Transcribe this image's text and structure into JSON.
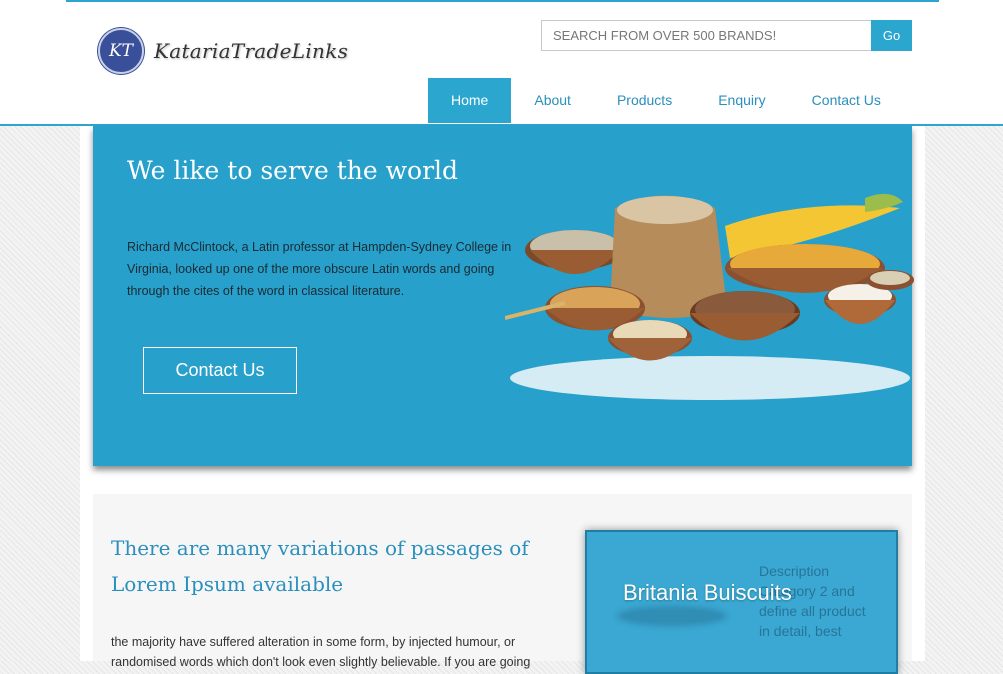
{
  "brand": {
    "logo_mark": "KT",
    "name": "KatariaTradeLinks"
  },
  "search": {
    "placeholder": "SEARCH FROM OVER 500 BRANDS!",
    "button_label": "Go"
  },
  "nav": [
    {
      "label": "Home",
      "active": true
    },
    {
      "label": "About"
    },
    {
      "label": "Products"
    },
    {
      "label": "Enquiry"
    },
    {
      "label": "Contact Us"
    }
  ],
  "hero": {
    "title": "We like to serve the world",
    "text": "Richard McClintock, a Latin professor at Hampden-Sydney College in Virginia, looked up one of the more obscure Latin words and going through the cites of the word in classical literature.",
    "button_label": "Contact Us",
    "image_icon": "grains-bowls-image"
  },
  "section": {
    "title": "There are many variations of passages of Lorem Ipsum available",
    "text": "the majority have suffered alteration in some form, by injected humour, or randomised words which don't look even slightly believable. If you are going"
  },
  "card": {
    "title": "Britania Buiscuits",
    "description": "Description Category 2 and define all product in detail, best"
  },
  "colors": {
    "accent": "#2aa6cf",
    "hero_bg": "#27a0cb",
    "link": "#2a8fbd"
  }
}
